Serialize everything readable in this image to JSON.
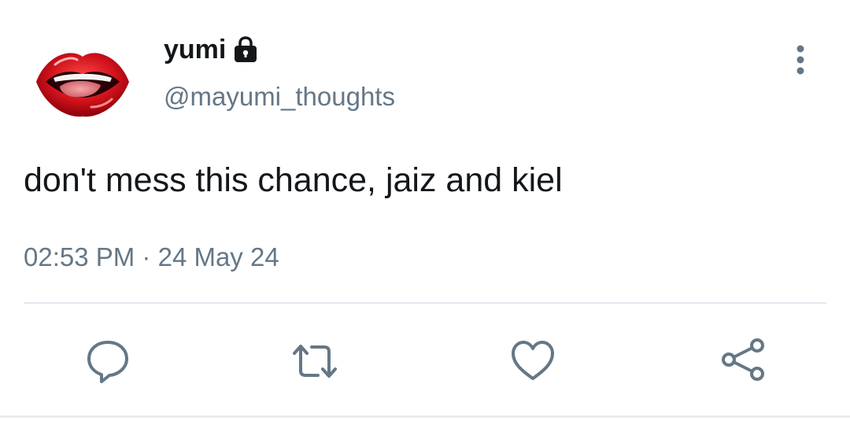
{
  "user": {
    "display_name": "yumi",
    "handle": "@mayumi_thoughts",
    "avatar": "red-lips-avatar",
    "protected_icon": "lock-icon"
  },
  "tweet": {
    "text": "don't mess this chance, jaiz and kiel",
    "time": "02:53 PM",
    "separator": "·",
    "date": "24 May 24"
  },
  "actions": [
    {
      "name": "reply",
      "icon": "speech-bubble-icon"
    },
    {
      "name": "retweet",
      "icon": "retweet-arrows-icon"
    },
    {
      "name": "like",
      "icon": "heart-icon"
    },
    {
      "name": "share",
      "icon": "share-nodes-icon"
    }
  ],
  "colors": {
    "text_primary": "#14171a",
    "text_secondary": "#657786",
    "icon": "#657786",
    "divider": "#e1e8ed",
    "lips_red": "#d0121b"
  }
}
